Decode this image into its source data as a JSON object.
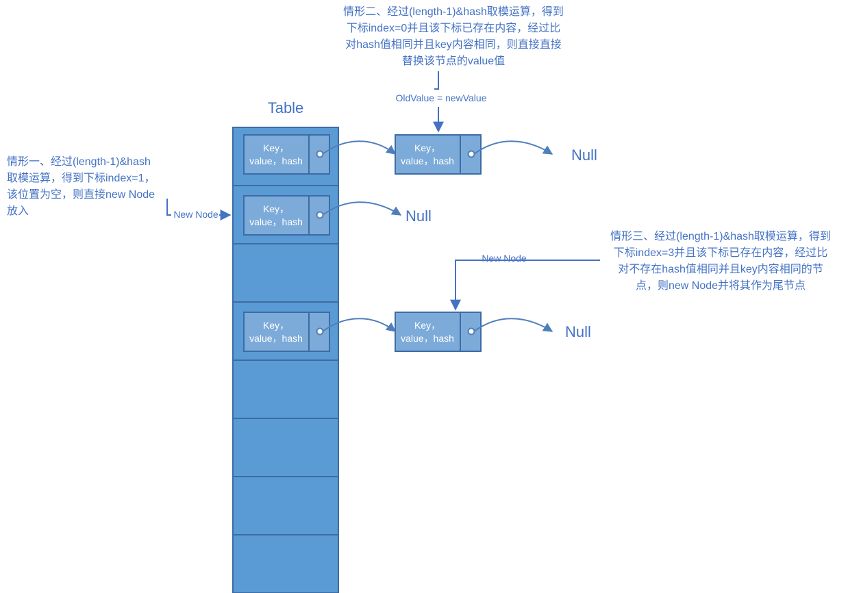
{
  "title": "Table",
  "nodeLabel": {
    "line1": "Key，",
    "line2": "value，hash"
  },
  "nulls": {
    "row0": "Null",
    "row1": "Null",
    "row3": "Null"
  },
  "case1": {
    "l1": "情形一、经过(length-1)&hash",
    "l2": "取模运算，得到下标index=1，",
    "l3": "该位置为空，则直接new Node",
    "l4": "放入"
  },
  "case1Label": "New Node",
  "case2": {
    "l1": "情形二、经过(length-1)&hash取模运算，得到",
    "l2": "下标index=0并且该下标已存在内容，经过比",
    "l3": "对hash值相同并且key内容相同，则直接直接",
    "l4": "替换该节点的value值"
  },
  "case2Label": "OldValue = newValue",
  "case3": {
    "l1": "情形三、经过(length-1)&hash取模运算，得到",
    "l2": "下标index=3并且该下标已存在内容，经过比",
    "l3": "对不存在hash值相同并且key内容相同的节",
    "l4": "点，则new Node并将其作为尾节点"
  },
  "case3Label": "New Node",
  "colors": {
    "primary": "#4472c4",
    "cellFill": "#5b9bd5",
    "cellStroke": "#3c6ca5",
    "nodeFill": "#7dabd9",
    "link": "#4f7fbb"
  }
}
